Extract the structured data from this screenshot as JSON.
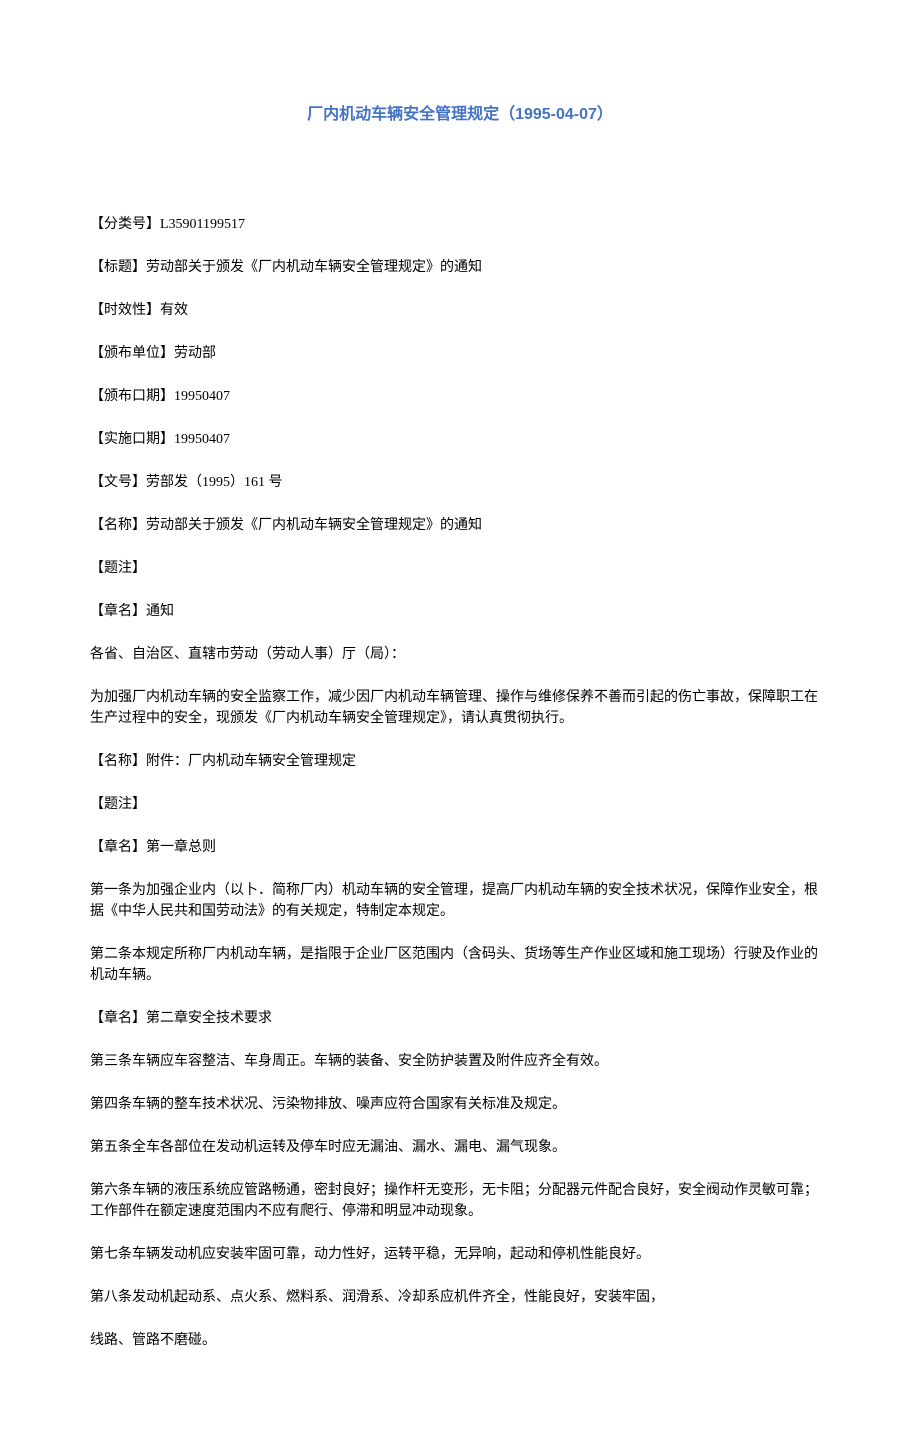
{
  "title": "厂内机动车辆安全管理规定（1995-04-07）",
  "paragraphs": [
    "【分类号】L35901199517",
    "【标题】劳动部关于颁发《厂内机动车辆安全管理规定》的通知",
    "【时效性】有效",
    "【颁布单位】劳动部",
    "【颁布口期】19950407",
    "【实施口期】19950407",
    "【文号】劳部发（1995）161 号",
    "【名称】劳动部关于颁发《厂内机动车辆安全管理规定》的通知",
    "【题注】",
    "【章名】通知",
    "各省、自治区、直辖市劳动（劳动人事）厅（局）：",
    "为加强厂内机动车辆的安全监察工作，减少因厂内机动车辆管理、操作与维修保养不善而引起的伤亡事故，保障职工在生产过程中的安全，现颁发《厂内机动车辆安全管理规定》，请认真贯彻执行。",
    "【名称】附件：厂内机动车辆安全管理规定",
    "【题注】",
    "【章名】第一章总则",
    "第一条为加强企业内（以卜．简称厂内）机动车辆的安全管理，提高厂内机动车辆的安全技术状况，保障作业安全，根据《中华人民共和国劳动法》的有关规定，特制定本规定。",
    "第二条本规定所称厂内机动车辆，是指限于企业厂区范围内（含码头、货场等生产作业区域和施工现场）行驶及作业的机动车辆。",
    "【章名】第二章安全技术要求",
    "第三条车辆应车容整洁、车身周正。车辆的装备、安全防护装置及附件应齐全有效。",
    "第四条车辆的整车技术状况、污染物排放、噪声应符合国家有关标准及规定。",
    "第五条全车各部位在发动机运转及停车时应无漏油、漏水、漏电、漏气现象。",
    "第六条车辆的液压系统应管路畅通，密封良好；操作杆无变形，无卡阻；分配器元件配合良好，安全阀动作灵敏可靠；工作部件在额定速度范围内不应有爬行、停滞和明显冲动现象。",
    "第七条车辆发动机应安装牢固可靠，动力性好，运转平稳，无异响，起动和停机性能良好。",
    "第八条发动机起动系、点火系、燃料系、润滑系、冷却系应机件齐全，性能良好，安装牢固，",
    "线路、管路不磨碰。"
  ]
}
